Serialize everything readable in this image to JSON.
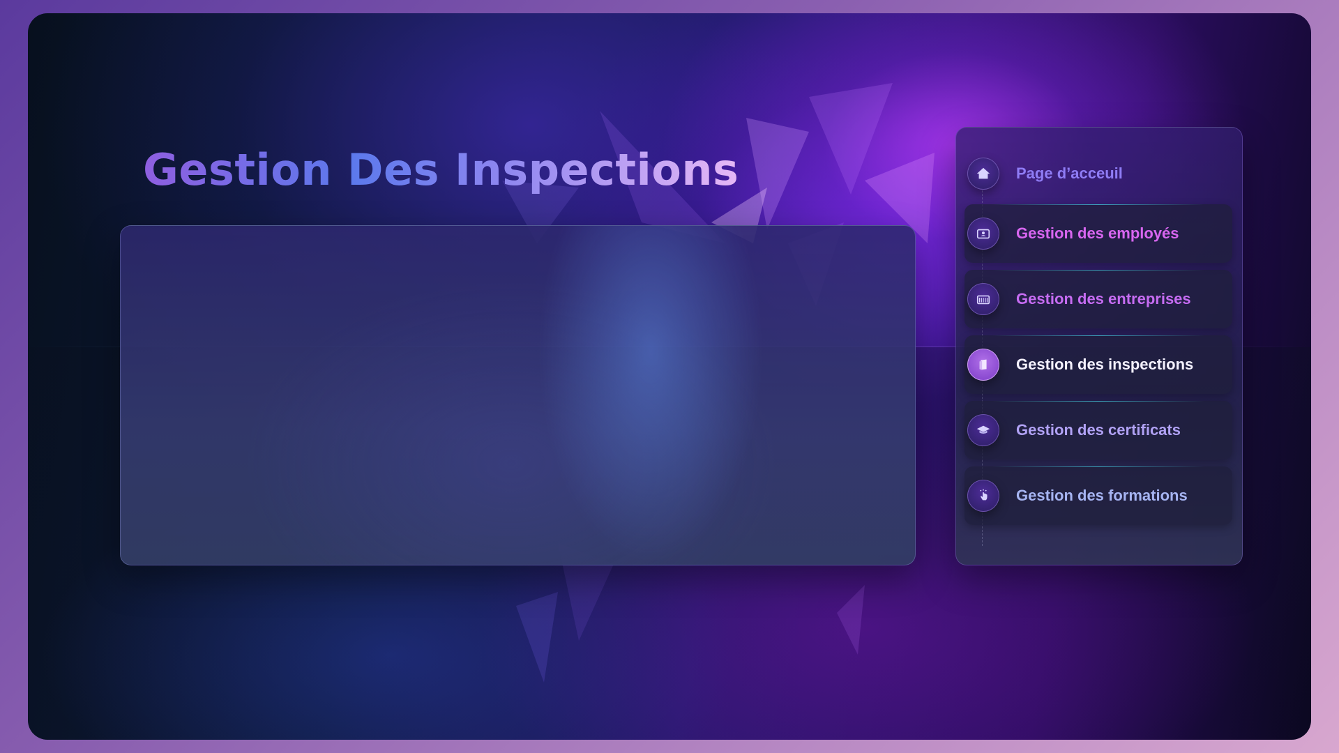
{
  "page": {
    "title": "Gestion Des Inspections"
  },
  "nav": {
    "items": [
      {
        "label": "Page d’acceuil",
        "icon": "home-icon",
        "color": "#8f7cf5",
        "active": false
      },
      {
        "label": "Gestion des employés",
        "icon": "id-card-icon",
        "color": "#d866f0",
        "active": false
      },
      {
        "label": "Gestion des entreprises",
        "icon": "building-icon",
        "color": "#c66cf2",
        "active": false
      },
      {
        "label": "Gestion des inspections",
        "icon": "clipboard-icon",
        "color": "#f4f1ff",
        "active": true
      },
      {
        "label": "Gestion des certificats",
        "icon": "graduation-cap-icon",
        "color": "#b1a2f5",
        "active": false
      },
      {
        "label": "Gestion des formations",
        "icon": "pointer-hand-icon",
        "color": "#a6b4f2",
        "active": false
      }
    ]
  },
  "colors": {
    "title_gradient_start": "#8f5fe0",
    "title_gradient_end": "#e6b8f6",
    "active_icon": "#9a56dc",
    "accent_line": "#46d2e6"
  }
}
